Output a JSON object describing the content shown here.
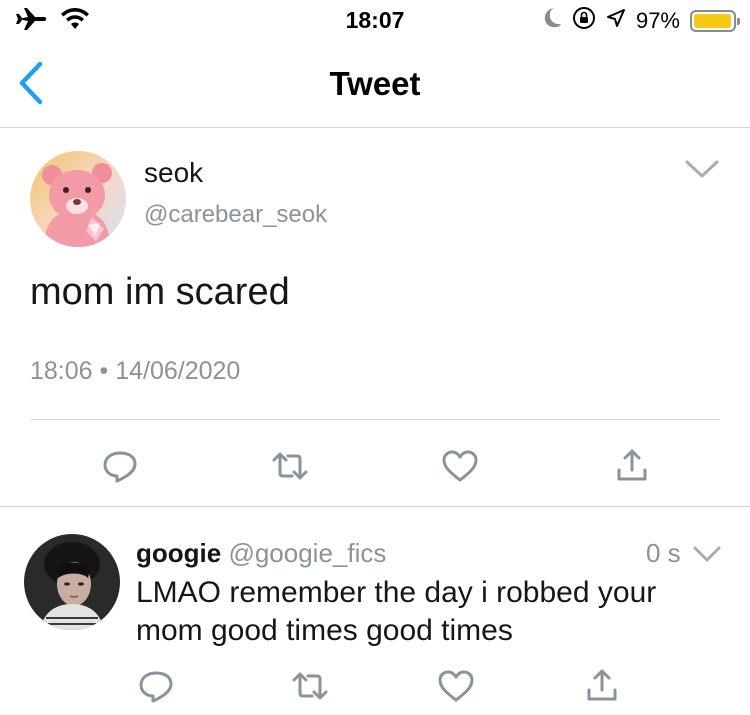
{
  "status_bar": {
    "time": "18:07",
    "battery_percent": "97%",
    "battery_level": 0.97,
    "battery_color": "#f6c915",
    "icons": [
      "airplane-icon",
      "wifi-icon",
      "moon-icon",
      "orientation-lock-icon",
      "location-icon",
      "battery-icon"
    ]
  },
  "nav": {
    "title": "Tweet",
    "back_icon": "chevron-left-icon",
    "accent_color": "#1da1f2"
  },
  "main_tweet": {
    "display_name": "seok",
    "handle": "@carebear_seok",
    "text": "mom im scared",
    "timestamp": "18:06 • 14/06/2020",
    "menu_icon": "chevron-down-icon",
    "actions": [
      "reply-icon",
      "retweet-icon",
      "like-icon",
      "share-icon"
    ]
  },
  "reply": {
    "display_name": "googie",
    "handle": "@googie_fics",
    "time": "0 s",
    "text": "LMAO remember the day i robbed your mom good times good times",
    "menu_icon": "chevron-down-icon",
    "actions": [
      "reply-icon",
      "retweet-icon",
      "like-icon",
      "share-icon"
    ]
  },
  "colors": {
    "text_primary": "#14171a",
    "text_secondary": "#8a939b",
    "icon_gray": "#8a939b",
    "divider": "#cfd4d8"
  }
}
